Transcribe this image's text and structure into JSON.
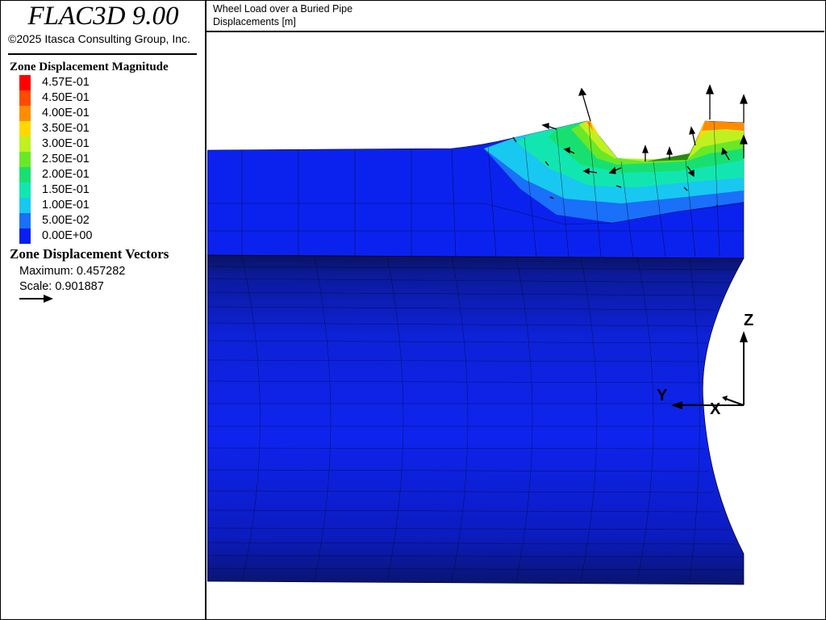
{
  "app": {
    "title": "FLAC3D 9.00",
    "copyright": "©2025 Itasca Consulting Group, Inc."
  },
  "plot": {
    "title": "Wheel Load over a Buried Pipe",
    "subtitle": "Displacements [m]"
  },
  "legend": {
    "heading": "Zone Displacement Magnitude",
    "items": [
      {
        "label": "4.57E-01",
        "color": "#ff0000"
      },
      {
        "label": "4.50E-01",
        "color": "#ff4a00"
      },
      {
        "label": "4.00E-01",
        "color": "#ff8c00"
      },
      {
        "label": "3.50E-01",
        "color": "#ffd800"
      },
      {
        "label": "3.00E-01",
        "color": "#c0f020"
      },
      {
        "label": "2.50E-01",
        "color": "#6ae828"
      },
      {
        "label": "2.00E-01",
        "color": "#18e070"
      },
      {
        "label": "1.50E-01",
        "color": "#12e6b0"
      },
      {
        "label": "1.00E-01",
        "color": "#18c8f0"
      },
      {
        "label": "5.00E-02",
        "color": "#1a70f8"
      },
      {
        "label": "0.00E+00",
        "color": "#0a1ef0"
      }
    ]
  },
  "vectors": {
    "heading": "Zone Displacement Vectors",
    "maximum": "Maximum: 0.457282",
    "scale": "Scale: 0.901887"
  },
  "axes": {
    "z": "Z",
    "y": "Y",
    "x": "X"
  }
}
